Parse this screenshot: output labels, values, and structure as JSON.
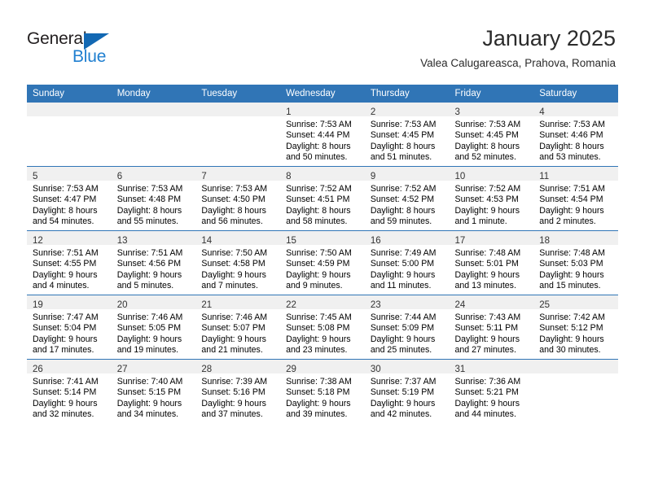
{
  "brand": {
    "name_part1": "General",
    "name_part2": "Blue",
    "accent_color": "#1f7fd0",
    "triangle_color": "#1268b3"
  },
  "header": {
    "title": "January 2025",
    "subtitle": "Valea Calugareasca, Prahova, Romania"
  },
  "calendar": {
    "header_bg": "#3075b6",
    "daynum_band_bg": "#f0f0f0",
    "weekday_headers": [
      "Sunday",
      "Monday",
      "Tuesday",
      "Wednesday",
      "Thursday",
      "Friday",
      "Saturday"
    ],
    "weeks": [
      [
        {
          "day": "",
          "lines": []
        },
        {
          "day": "",
          "lines": []
        },
        {
          "day": "",
          "lines": []
        },
        {
          "day": "1",
          "lines": [
            "Sunrise: 7:53 AM",
            "Sunset: 4:44 PM",
            "Daylight: 8 hours",
            "and 50 minutes."
          ]
        },
        {
          "day": "2",
          "lines": [
            "Sunrise: 7:53 AM",
            "Sunset: 4:45 PM",
            "Daylight: 8 hours",
            "and 51 minutes."
          ]
        },
        {
          "day": "3",
          "lines": [
            "Sunrise: 7:53 AM",
            "Sunset: 4:45 PM",
            "Daylight: 8 hours",
            "and 52 minutes."
          ]
        },
        {
          "day": "4",
          "lines": [
            "Sunrise: 7:53 AM",
            "Sunset: 4:46 PM",
            "Daylight: 8 hours",
            "and 53 minutes."
          ]
        }
      ],
      [
        {
          "day": "5",
          "lines": [
            "Sunrise: 7:53 AM",
            "Sunset: 4:47 PM",
            "Daylight: 8 hours",
            "and 54 minutes."
          ]
        },
        {
          "day": "6",
          "lines": [
            "Sunrise: 7:53 AM",
            "Sunset: 4:48 PM",
            "Daylight: 8 hours",
            "and 55 minutes."
          ]
        },
        {
          "day": "7",
          "lines": [
            "Sunrise: 7:53 AM",
            "Sunset: 4:50 PM",
            "Daylight: 8 hours",
            "and 56 minutes."
          ]
        },
        {
          "day": "8",
          "lines": [
            "Sunrise: 7:52 AM",
            "Sunset: 4:51 PM",
            "Daylight: 8 hours",
            "and 58 minutes."
          ]
        },
        {
          "day": "9",
          "lines": [
            "Sunrise: 7:52 AM",
            "Sunset: 4:52 PM",
            "Daylight: 8 hours",
            "and 59 minutes."
          ]
        },
        {
          "day": "10",
          "lines": [
            "Sunrise: 7:52 AM",
            "Sunset: 4:53 PM",
            "Daylight: 9 hours",
            "and 1 minute."
          ]
        },
        {
          "day": "11",
          "lines": [
            "Sunrise: 7:51 AM",
            "Sunset: 4:54 PM",
            "Daylight: 9 hours",
            "and 2 minutes."
          ]
        }
      ],
      [
        {
          "day": "12",
          "lines": [
            "Sunrise: 7:51 AM",
            "Sunset: 4:55 PM",
            "Daylight: 9 hours",
            "and 4 minutes."
          ]
        },
        {
          "day": "13",
          "lines": [
            "Sunrise: 7:51 AM",
            "Sunset: 4:56 PM",
            "Daylight: 9 hours",
            "and 5 minutes."
          ]
        },
        {
          "day": "14",
          "lines": [
            "Sunrise: 7:50 AM",
            "Sunset: 4:58 PM",
            "Daylight: 9 hours",
            "and 7 minutes."
          ]
        },
        {
          "day": "15",
          "lines": [
            "Sunrise: 7:50 AM",
            "Sunset: 4:59 PM",
            "Daylight: 9 hours",
            "and 9 minutes."
          ]
        },
        {
          "day": "16",
          "lines": [
            "Sunrise: 7:49 AM",
            "Sunset: 5:00 PM",
            "Daylight: 9 hours",
            "and 11 minutes."
          ]
        },
        {
          "day": "17",
          "lines": [
            "Sunrise: 7:48 AM",
            "Sunset: 5:01 PM",
            "Daylight: 9 hours",
            "and 13 minutes."
          ]
        },
        {
          "day": "18",
          "lines": [
            "Sunrise: 7:48 AM",
            "Sunset: 5:03 PM",
            "Daylight: 9 hours",
            "and 15 minutes."
          ]
        }
      ],
      [
        {
          "day": "19",
          "lines": [
            "Sunrise: 7:47 AM",
            "Sunset: 5:04 PM",
            "Daylight: 9 hours",
            "and 17 minutes."
          ]
        },
        {
          "day": "20",
          "lines": [
            "Sunrise: 7:46 AM",
            "Sunset: 5:05 PM",
            "Daylight: 9 hours",
            "and 19 minutes."
          ]
        },
        {
          "day": "21",
          "lines": [
            "Sunrise: 7:46 AM",
            "Sunset: 5:07 PM",
            "Daylight: 9 hours",
            "and 21 minutes."
          ]
        },
        {
          "day": "22",
          "lines": [
            "Sunrise: 7:45 AM",
            "Sunset: 5:08 PM",
            "Daylight: 9 hours",
            "and 23 minutes."
          ]
        },
        {
          "day": "23",
          "lines": [
            "Sunrise: 7:44 AM",
            "Sunset: 5:09 PM",
            "Daylight: 9 hours",
            "and 25 minutes."
          ]
        },
        {
          "day": "24",
          "lines": [
            "Sunrise: 7:43 AM",
            "Sunset: 5:11 PM",
            "Daylight: 9 hours",
            "and 27 minutes."
          ]
        },
        {
          "day": "25",
          "lines": [
            "Sunrise: 7:42 AM",
            "Sunset: 5:12 PM",
            "Daylight: 9 hours",
            "and 30 minutes."
          ]
        }
      ],
      [
        {
          "day": "26",
          "lines": [
            "Sunrise: 7:41 AM",
            "Sunset: 5:14 PM",
            "Daylight: 9 hours",
            "and 32 minutes."
          ]
        },
        {
          "day": "27",
          "lines": [
            "Sunrise: 7:40 AM",
            "Sunset: 5:15 PM",
            "Daylight: 9 hours",
            "and 34 minutes."
          ]
        },
        {
          "day": "28",
          "lines": [
            "Sunrise: 7:39 AM",
            "Sunset: 5:16 PM",
            "Daylight: 9 hours",
            "and 37 minutes."
          ]
        },
        {
          "day": "29",
          "lines": [
            "Sunrise: 7:38 AM",
            "Sunset: 5:18 PM",
            "Daylight: 9 hours",
            "and 39 minutes."
          ]
        },
        {
          "day": "30",
          "lines": [
            "Sunrise: 7:37 AM",
            "Sunset: 5:19 PM",
            "Daylight: 9 hours",
            "and 42 minutes."
          ]
        },
        {
          "day": "31",
          "lines": [
            "Sunrise: 7:36 AM",
            "Sunset: 5:21 PM",
            "Daylight: 9 hours",
            "and 44 minutes."
          ]
        },
        {
          "day": "",
          "lines": []
        }
      ]
    ]
  }
}
